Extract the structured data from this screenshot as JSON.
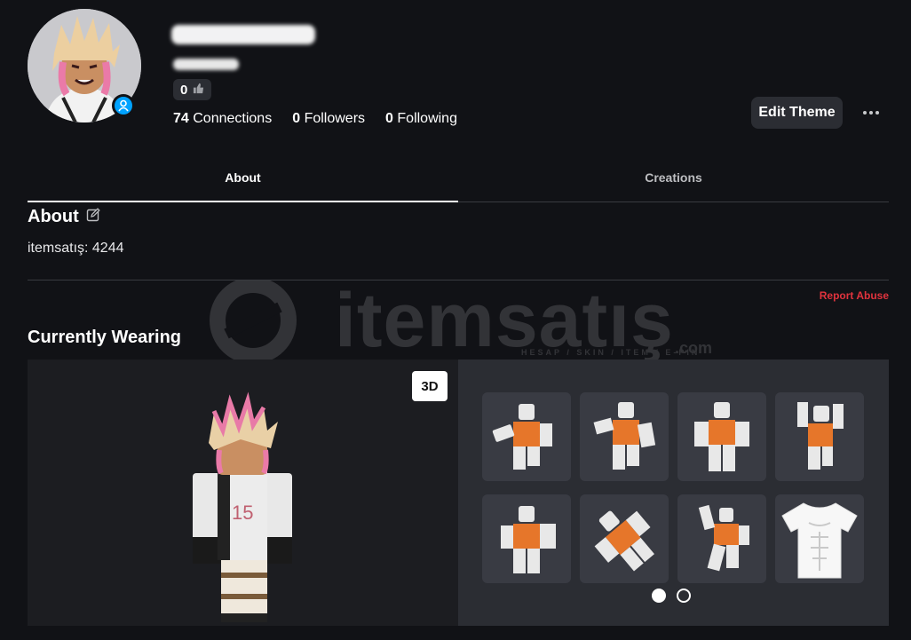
{
  "profile": {
    "likes": "0",
    "stats": [
      {
        "num": "74",
        "label": "Connections"
      },
      {
        "num": "0",
        "label": "Followers"
      },
      {
        "num": "0",
        "label": "Following"
      }
    ],
    "edit_theme": "Edit Theme"
  },
  "tabs": [
    "About",
    "Creations"
  ],
  "about": {
    "title": "About",
    "text": "itemsatış: 4244",
    "report": "Report Abuse"
  },
  "watermark": {
    "brand": "itemsatış",
    "tagline": "HESAP / SKIN / ITEM / E-PIN",
    "suffix": ".com"
  },
  "wearing": {
    "title": "Currently Wearing",
    "view_toggle": "3D",
    "items": [
      {
        "icon": "animation-pose-icon"
      },
      {
        "icon": "animation-pose-icon"
      },
      {
        "icon": "animation-pose-icon"
      },
      {
        "icon": "animation-pose-icon"
      },
      {
        "icon": "animation-pose-icon"
      },
      {
        "icon": "animation-pose-icon"
      },
      {
        "icon": "animation-pose-icon"
      },
      {
        "icon": "shirt-icon"
      }
    ],
    "page_count": 2,
    "current_page": 1
  },
  "colors": {
    "accent": "#00a2ff",
    "report": "#e0333d",
    "bg": "#111216",
    "panel": "#2b2d33"
  }
}
